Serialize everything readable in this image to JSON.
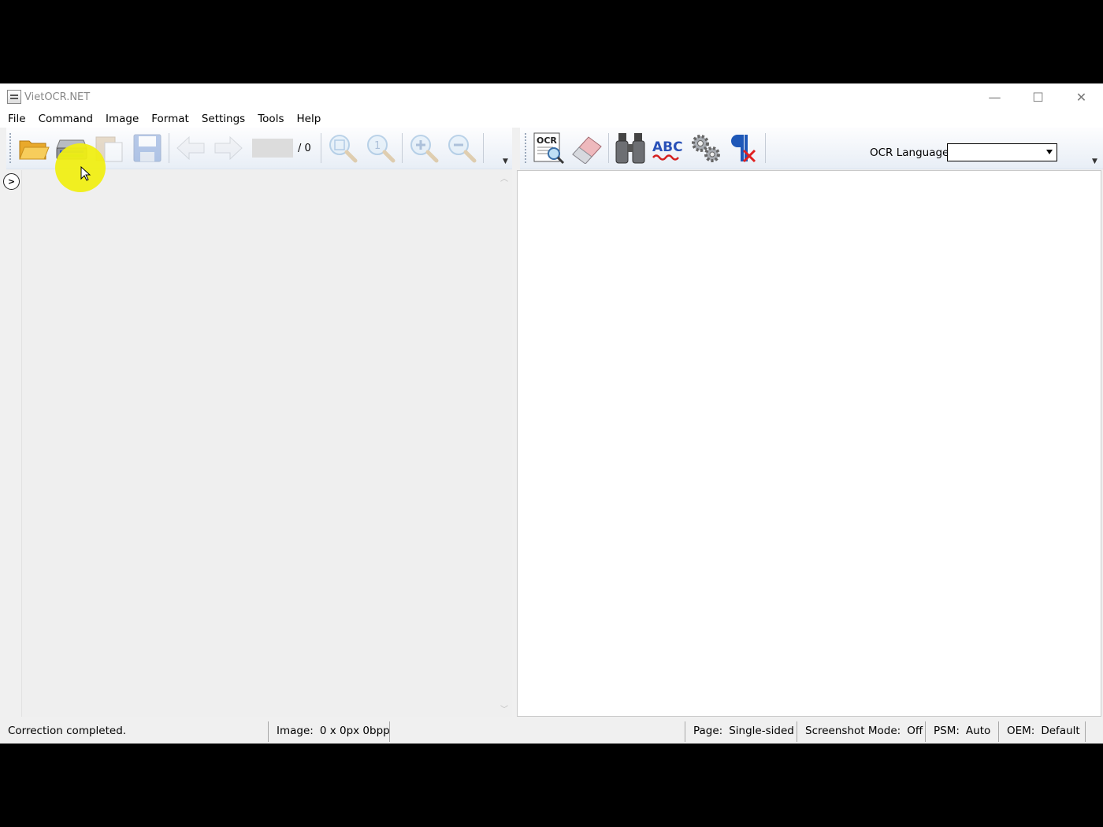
{
  "window": {
    "title": "VietOCR.NET",
    "controls": {
      "minimize": "—",
      "maximize": "☐",
      "close": "✕"
    }
  },
  "menu": {
    "items": [
      "File",
      "Command",
      "Image",
      "Format",
      "Settings",
      "Tools",
      "Help"
    ]
  },
  "toolbar_left": {
    "buttons": [
      {
        "name": "open-icon",
        "enabled": true
      },
      {
        "name": "scan-icon",
        "enabled": true
      },
      {
        "name": "paste-icon",
        "enabled": false
      },
      {
        "name": "save-icon",
        "enabled": false
      },
      {
        "name": "prev-page-icon",
        "enabled": false
      },
      {
        "name": "next-page-icon",
        "enabled": false
      },
      {
        "name": "fit-image-icon",
        "enabled": false
      },
      {
        "name": "actual-size-icon",
        "enabled": false
      },
      {
        "name": "zoom-in-icon",
        "enabled": false
      },
      {
        "name": "zoom-out-icon",
        "enabled": false
      }
    ],
    "page_count": "/ 0"
  },
  "toolbar_right": {
    "buttons": [
      {
        "name": "ocr-icon",
        "label": "OCR"
      },
      {
        "name": "eraser-icon"
      },
      {
        "name": "binoculars-icon"
      },
      {
        "name": "spellcheck-icon",
        "label": "ABC"
      },
      {
        "name": "settings-gears-icon"
      },
      {
        "name": "remove-line-breaks-icon"
      }
    ],
    "ocr_language_label": "OCR Language",
    "ocr_language_value": ""
  },
  "statusbar": {
    "message": "Correction completed.",
    "image_label": "Image:",
    "image_value": "0 x 0px 0bpp",
    "page_label": "Page:",
    "page_value": "Single-sided",
    "screenshot_label": "Screenshot Mode:",
    "screenshot_value": "Off",
    "psm_label": "PSM:",
    "psm_value": "Auto",
    "oem_label": "OEM:",
    "oem_value": "Default"
  },
  "colors": {
    "toolbar_top": "#fdfdfe",
    "toolbar_bottom": "#e8eef6",
    "cursor_highlight": "#f0ee14"
  }
}
